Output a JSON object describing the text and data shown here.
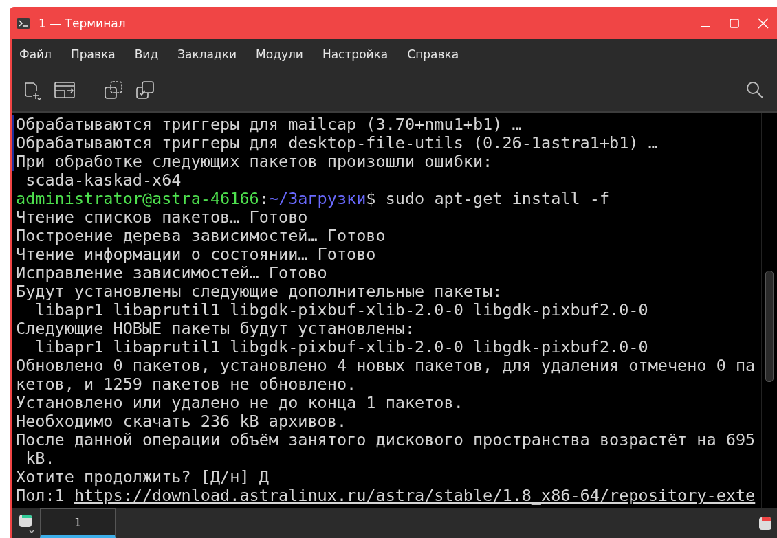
{
  "window": {
    "title": "1 — Терминал"
  },
  "menu": [
    "Файл",
    "Правка",
    "Вид",
    "Закладки",
    "Модули",
    "Настройка",
    "Справка"
  ],
  "terminal": {
    "lines": [
      {
        "kind": "text",
        "marked": true,
        "text": "Обрабатываются триггеры для mailcap (3.70+nmu1+b1) …"
      },
      {
        "kind": "text",
        "marked": true,
        "text": "Обрабатываются триггеры для desktop-file-utils (0.26-1astra1+b1) …"
      },
      {
        "kind": "text",
        "marked": true,
        "text": "При обработке следующих пакетов произошли ошибки:"
      },
      {
        "kind": "text",
        "marked": false,
        "text": " scada-kaskad-x64"
      },
      {
        "kind": "prompt",
        "marked": false,
        "user": "administrator@astra-46166",
        "sep": ":",
        "path": "~/Загрузки",
        "command": "$ sudo apt-get install -f"
      },
      {
        "kind": "text",
        "marked": false,
        "text": "Чтение списков пакетов… Готово"
      },
      {
        "kind": "text",
        "marked": false,
        "text": "Построение дерева зависимостей… Готово"
      },
      {
        "kind": "text",
        "marked": false,
        "text": "Чтение информации о состоянии… Готово"
      },
      {
        "kind": "text",
        "marked": false,
        "text": "Исправление зависимостей… Готово"
      },
      {
        "kind": "text",
        "marked": false,
        "text": "Будут установлены следующие дополнительные пакеты:"
      },
      {
        "kind": "text",
        "marked": false,
        "text": "  libapr1 libaprutil1 libgdk-pixbuf-xlib-2.0-0 libgdk-pixbuf2.0-0"
      },
      {
        "kind": "text",
        "marked": false,
        "text": "Следующие НОВЫЕ пакеты будут установлены:"
      },
      {
        "kind": "text",
        "marked": false,
        "text": "  libapr1 libaprutil1 libgdk-pixbuf-xlib-2.0-0 libgdk-pixbuf2.0-0"
      },
      {
        "kind": "text",
        "marked": false,
        "text": "Обновлено 0 пакетов, установлено 4 новых пакетов, для удаления отмечено 0 па"
      },
      {
        "kind": "text",
        "marked": false,
        "text": "кетов, и 1259 пакетов не обновлено."
      },
      {
        "kind": "text",
        "marked": false,
        "text": "Установлено или удалено не до конца 1 пакетов."
      },
      {
        "kind": "text",
        "marked": false,
        "text": "Необходимо скачать 236 kB архивов."
      },
      {
        "kind": "text",
        "marked": false,
        "text": "После данной операции объём занятого дискового пространства возрастёт на 695"
      },
      {
        "kind": "text",
        "marked": false,
        "text": " kB."
      },
      {
        "kind": "text",
        "marked": false,
        "text": "Хотите продолжить? [Д/н] Д"
      },
      {
        "kind": "link",
        "marked": false,
        "prefix": "Пол:1 ",
        "url": "https://download.astralinux.ru/astra/stable/1.8_x86-64/repository-exte"
      }
    ]
  },
  "tabs": [
    {
      "label": "1",
      "selected": true
    }
  ]
}
